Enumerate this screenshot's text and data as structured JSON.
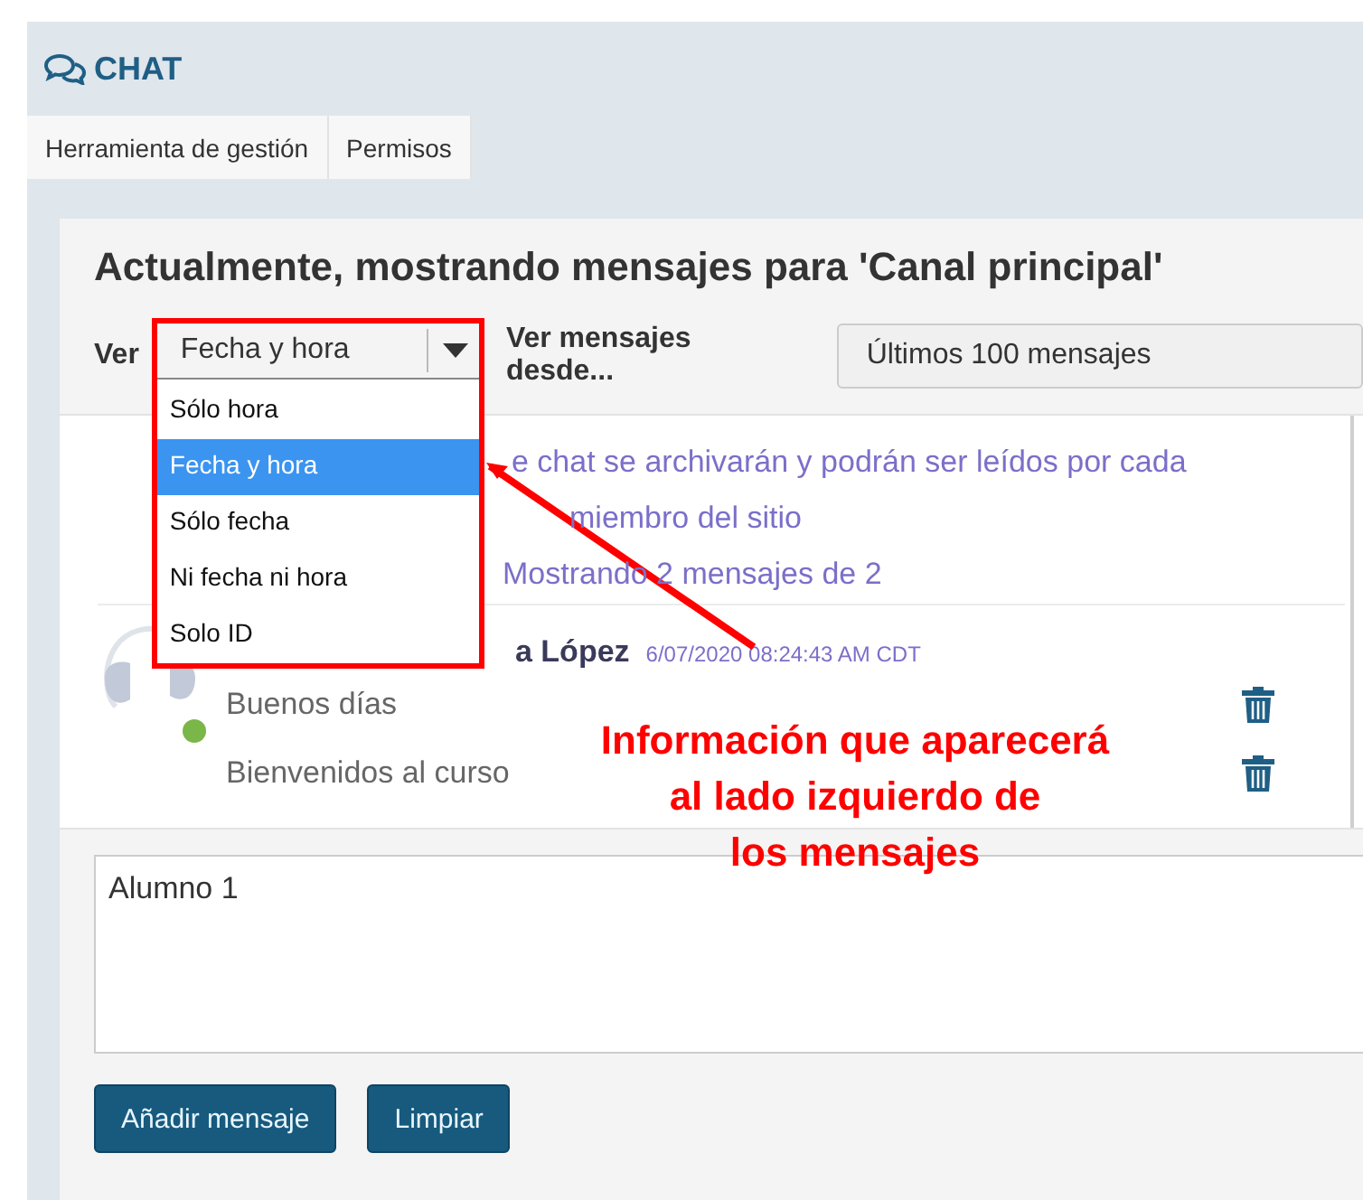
{
  "app": {
    "title": "CHAT"
  },
  "tabs": [
    {
      "label": "Herramienta de gestión"
    },
    {
      "label": "Permisos"
    }
  ],
  "heading": "Actualmente, mostrando mensajes para 'Canal principal'",
  "view": {
    "label": "Ver",
    "value": "Fecha y hora",
    "expanded": true,
    "options": [
      {
        "label": "Sólo hora",
        "selected": false
      },
      {
        "label": "Fecha y hora",
        "selected": true
      },
      {
        "label": "Sólo fecha",
        "selected": false
      },
      {
        "label": "Ni fecha ni hora",
        "selected": false
      },
      {
        "label": "Solo ID",
        "selected": false
      }
    ]
  },
  "since": {
    "label": "Ver mensajes desde...",
    "value": "Últimos 100 mensajes"
  },
  "notice": [
    "e chat se archivarán y podrán ser leídos por cada",
    "miembro del sitio",
    "Mostrando 2 mensajes de 2"
  ],
  "message_group": {
    "author": "a López",
    "time": "6/07/2020 08:24:43 AM CDT",
    "online": true,
    "messages": [
      {
        "text": "Buenos días"
      },
      {
        "text": "Bienvenidos al curso"
      }
    ]
  },
  "composer": {
    "value": "Alumno 1"
  },
  "buttons": [
    "Añadir mensaje",
    "Limpiar"
  ],
  "annotation": [
    "Información que aparecerá",
    "al lado izquierdo de",
    "los mensajes"
  ]
}
